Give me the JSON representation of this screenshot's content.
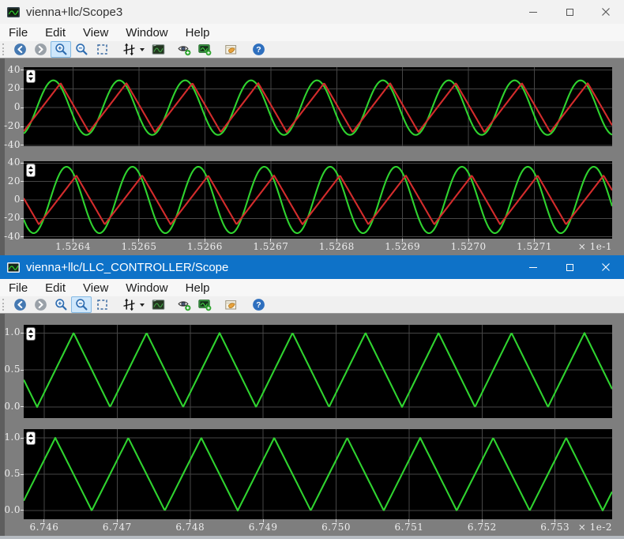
{
  "colors": {
    "active_titlebar": "#0e72c8",
    "inactive_titlebar": "#f2f2f2",
    "canvas_bg": "#7e7e7e",
    "plot_bg": "#000000",
    "grid_line": "#464646",
    "tick_text": "#ececec",
    "green_trace": "#2fd32f",
    "red_trace": "#d42c2c",
    "selected_tool_bg": "#cfe7fb"
  },
  "windows": [
    {
      "title": "vienna+llc/Scope3",
      "active": false,
      "app_icon": "scope-app-icon",
      "controls": [
        "minimize",
        "maximize",
        "close"
      ],
      "menu": [
        "File",
        "Edit",
        "View",
        "Window",
        "Help"
      ],
      "toolbar": [
        {
          "name": "back",
          "icon": "back-arrow-icon",
          "enabled": true
        },
        {
          "name": "forward",
          "icon": "forward-arrow-icon",
          "enabled": false
        },
        {
          "name": "zoom-in",
          "icon": "zoom-in-icon",
          "selected": true
        },
        {
          "name": "zoom-out",
          "icon": "zoom-out-icon",
          "selected": false
        },
        {
          "name": "fit-to-view",
          "icon": "fit-to-view-icon"
        },
        {
          "name": "axes-scaling",
          "icon": "axes-scaling-icon",
          "has_dropdown": true
        },
        {
          "name": "display-settings",
          "icon": "display-settings-icon"
        },
        {
          "name": "highlight-block",
          "icon": "eye-highlight-icon"
        },
        {
          "name": "open-scope",
          "icon": "scope-window-icon"
        },
        {
          "name": "signal-properties",
          "icon": "properties-icon"
        },
        {
          "name": "help",
          "icon": "help-icon"
        }
      ],
      "xaxis": {
        "xlim": [
          1.526325,
          1.527218
        ],
        "ticks": [
          1.5264,
          1.5265,
          1.5266,
          1.5267,
          1.5268,
          1.5269,
          1.527,
          1.5271
        ],
        "tick_labels": [
          "1.5264",
          "1.5265",
          "1.5266",
          "1.5267",
          "1.5268",
          "1.5269",
          "1.5270",
          "1.5271"
        ],
        "scale_label": "× 1e-1"
      },
      "plots": [
        {
          "name": "axes-1",
          "ylim": [
            -41,
            43
          ],
          "yticks": [
            40,
            20,
            0,
            -20,
            -40
          ],
          "ytick_labels": [
            "40",
            "20",
            "0",
            "-20",
            "-40"
          ],
          "show_xticks": false,
          "series": [
            {
              "name": "green-sine",
              "color": "#2fd32f",
              "type": "sine",
              "amplitude": 29,
              "offset": 0,
              "period": 0.0001,
              "x_peak": 1.52637
            },
            {
              "name": "red-triangle",
              "color": "#d42c2c",
              "type": "triangle",
              "amplitude": 26,
              "offset": 0,
              "period": 0.0001,
              "x_peak": 1.526381,
              "fall_frac": 0.43
            }
          ]
        },
        {
          "name": "axes-2",
          "ylim": [
            -42,
            42
          ],
          "yticks": [
            40,
            20,
            0,
            -20,
            -40
          ],
          "ytick_labels": [
            "40",
            "20",
            "0",
            "-20",
            "-40"
          ],
          "show_xticks": true,
          "series": [
            {
              "name": "green-sine",
              "color": "#2fd32f",
              "type": "sine",
              "amplitude": 36,
              "offset": 0,
              "period": 0.0001,
              "x_peak": 1.52639
            },
            {
              "name": "red-triangle",
              "color": "#d42c2c",
              "type": "triangle",
              "amplitude": 26.5,
              "offset": 0,
              "period": 0.0001,
              "x_peak": 1.526405,
              "fall_frac": 0.43
            }
          ]
        }
      ]
    },
    {
      "title": "vienna+llc/LLC_CONTROLLER/Scope",
      "active": true,
      "app_icon": "scope-app-icon",
      "controls": [
        "minimize",
        "maximize",
        "close"
      ],
      "menu": [
        "File",
        "Edit",
        "View",
        "Window",
        "Help"
      ],
      "toolbar": [
        {
          "name": "back",
          "icon": "back-arrow-icon",
          "enabled": true
        },
        {
          "name": "forward",
          "icon": "forward-arrow-icon",
          "enabled": false
        },
        {
          "name": "zoom-in",
          "icon": "zoom-in-icon",
          "selected": false
        },
        {
          "name": "zoom-out",
          "icon": "zoom-out-icon",
          "selected": true
        },
        {
          "name": "fit-to-view",
          "icon": "fit-to-view-icon"
        },
        {
          "name": "axes-scaling",
          "icon": "axes-scaling-icon",
          "has_dropdown": true
        },
        {
          "name": "display-settings",
          "icon": "display-settings-icon"
        },
        {
          "name": "highlight-block",
          "icon": "eye-highlight-icon"
        },
        {
          "name": "open-scope",
          "icon": "scope-window-icon"
        },
        {
          "name": "signal-properties",
          "icon": "properties-icon"
        },
        {
          "name": "help",
          "icon": "help-icon"
        }
      ],
      "xaxis": {
        "xlim": [
          6.745719,
          6.753782
        ],
        "ticks": [
          6.746,
          6.747,
          6.748,
          6.749,
          6.75,
          6.751,
          6.752,
          6.753
        ],
        "tick_labels": [
          "6.746",
          "6.747",
          "6.748",
          "6.749",
          "6.750",
          "6.751",
          "6.752",
          "6.753"
        ],
        "scale_label": "× 1e-2"
      },
      "plots": [
        {
          "name": "axes-1",
          "ylim": [
            -0.15,
            1.11
          ],
          "yticks": [
            1.0,
            0.5,
            0.0
          ],
          "ytick_labels": [
            "1.0",
            "0.5",
            "0.0"
          ],
          "show_xticks": false,
          "series": [
            {
              "name": "green-triangle",
              "color": "#2fd32f",
              "type": "triangle",
              "amplitude": 0.5,
              "offset": 0.5,
              "period": 0.001,
              "x_peak": 6.746403,
              "fall_frac": 0.5
            }
          ]
        },
        {
          "name": "axes-2",
          "ylim": [
            -0.12,
            1.12
          ],
          "yticks": [
            1.0,
            0.5,
            0.0
          ],
          "ytick_labels": [
            "1.0",
            "0.5",
            "0.0"
          ],
          "show_xticks": true,
          "series": [
            {
              "name": "green-triangle",
              "color": "#2fd32f",
              "type": "triangle",
              "amplitude": 0.5,
              "offset": 0.5,
              "period": 0.001,
              "x_peak": 6.746152,
              "fall_frac": 0.5
            }
          ]
        }
      ]
    }
  ]
}
